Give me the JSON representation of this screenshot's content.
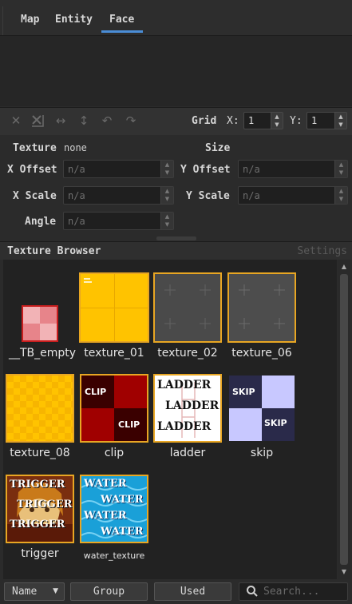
{
  "tabs": [
    {
      "label": "Map"
    },
    {
      "label": "Entity"
    },
    {
      "label": "Face",
      "active": true
    }
  ],
  "toolbar": {
    "icons": [
      "cross-icon",
      "cross-box-icon",
      "arrows-horizontal-icon",
      "arrows-vertical-icon",
      "undo-icon",
      "redo-icon"
    ],
    "grid_label": "Grid",
    "x_label": "X:",
    "x_value": "1",
    "y_label": "Y:",
    "y_value": "1"
  },
  "props": {
    "texture_label": "Texture",
    "texture_value": "none",
    "size_label": "Size",
    "x_offset_label": "X Offset",
    "x_offset_placeholder": "n/a",
    "y_offset_label": "Y Offset",
    "y_offset_placeholder": "n/a",
    "x_scale_label": "X Scale",
    "x_scale_placeholder": "n/a",
    "y_scale_label": "Y Scale",
    "y_scale_placeholder": "n/a",
    "angle_label": "Angle",
    "angle_placeholder": "n/a"
  },
  "browser": {
    "title": "Texture Browser",
    "settings": "Settings",
    "textures": [
      {
        "name": "__TB_empty"
      },
      {
        "name": "texture_01",
        "selected": true
      },
      {
        "name": "texture_02",
        "selected": true
      },
      {
        "name": "texture_06",
        "selected": true
      },
      {
        "name": "texture_08",
        "selected": true
      },
      {
        "name": "clip",
        "selected": true,
        "text": "CLIP"
      },
      {
        "name": "ladder",
        "selected": true,
        "text": "LADDER"
      },
      {
        "name": "skip",
        "text": "SKIP"
      },
      {
        "name": "trigger",
        "selected": true,
        "text": "TRIGGER"
      },
      {
        "name": "water_texture",
        "selected": true,
        "text": "WATER"
      }
    ]
  },
  "bottom": {
    "sort_label": "Name",
    "group_label": "Group",
    "used_label": "Used",
    "search_placeholder": "Search..."
  },
  "colors": {
    "accent": "#4a8dd6",
    "selection": "#e8a623"
  }
}
